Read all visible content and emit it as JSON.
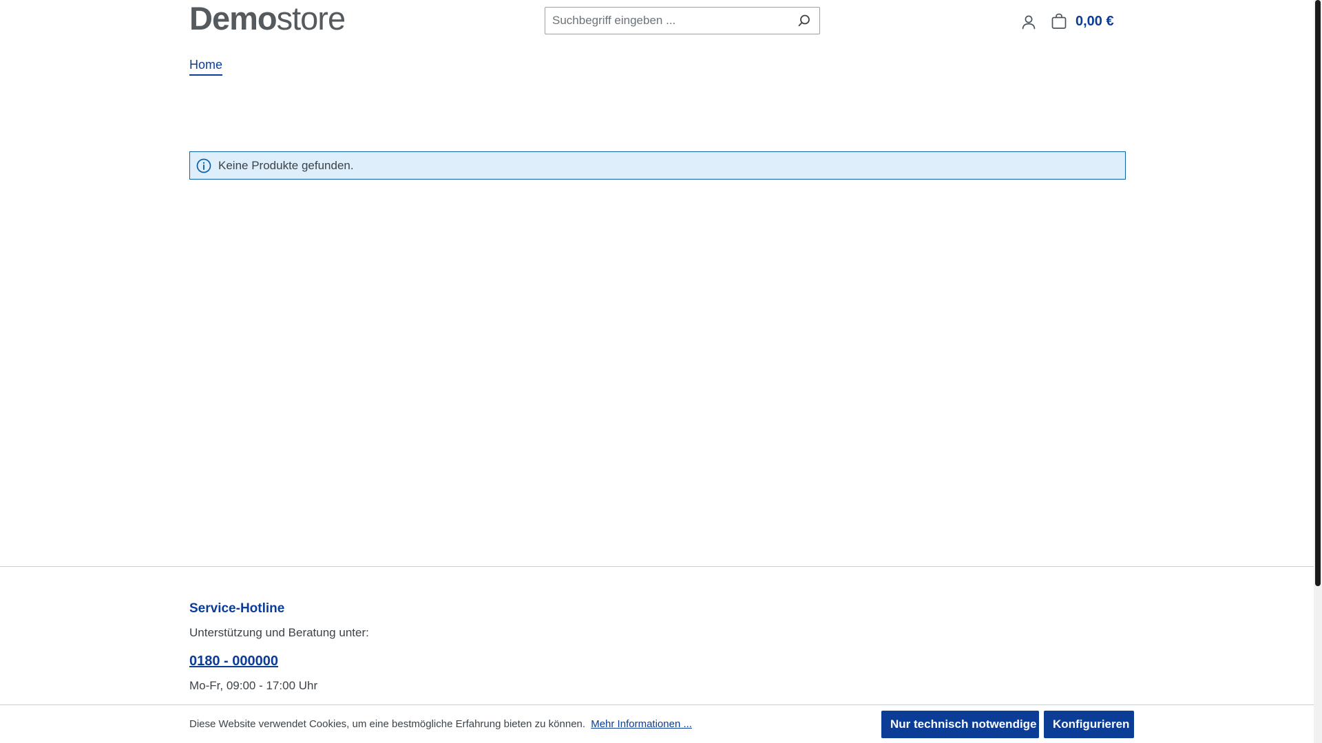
{
  "header": {
    "logo": {
      "bold": "Demo",
      "light": "store"
    },
    "search": {
      "placeholder": "Suchbegriff eingeben ..."
    },
    "cart": {
      "total": "0,00 €"
    }
  },
  "breadcrumb": {
    "home_label": "Home"
  },
  "alert": {
    "message": "Keine Produkte gefunden."
  },
  "footer": {
    "hotline_title": "Service-Hotline",
    "hotline_desc": "Unterstützung und Beratung unter:",
    "hotline_phone": "0180 - 000000",
    "hotline_hours": "Mo-Fr, 09:00 - 17:00 Uhr"
  },
  "cookie_bar": {
    "text": "Diese Website verwendet Cookies, um eine bestmögliche Erfahrung bieten zu können.",
    "link_label": "Mehr Informationen ...",
    "necessary_label": "Nur technisch notwendige",
    "configure_label": "Konfigurieren"
  },
  "colors": {
    "primary": "#0b3c96",
    "alert_bg": "#dfeefb",
    "alert_border": "#0b5ea8",
    "text": "#3b4248"
  },
  "icons": {
    "search": "search-icon",
    "account": "user-icon",
    "cart": "shopping-bag-icon",
    "info": "info-circle-icon"
  }
}
